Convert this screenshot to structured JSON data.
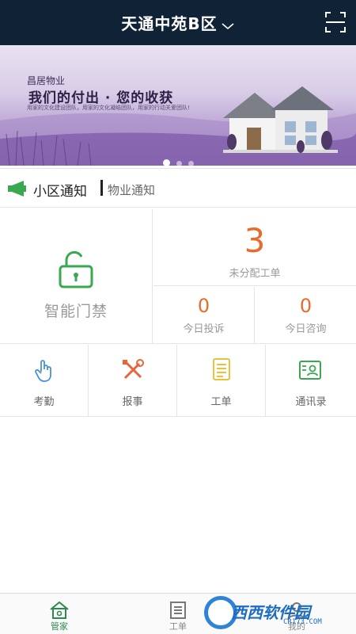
{
  "header": {
    "community_name": "天通中苑B区"
  },
  "banner": {
    "brand": "昌居物业",
    "slogan": "我们的付出 · 您的收获",
    "subtitle": "用家的文化建设团队，用家的文化凝结团队，用家的行动关爱团队!",
    "slide_count": 3,
    "active_slide": 1
  },
  "notice": {
    "primary_tab": "小区通知",
    "secondary_tab": "物业通知"
  },
  "gate": {
    "label": "智能门禁"
  },
  "stats": {
    "unassigned": {
      "value": "3",
      "label": "未分配工单"
    },
    "complaints": {
      "value": "0",
      "label": "今日投诉"
    },
    "inquiries": {
      "value": "0",
      "label": "今日咨询"
    }
  },
  "actions": [
    {
      "label": "考勤",
      "icon": "tap-hand-icon"
    },
    {
      "label": "报事",
      "icon": "tools-icon"
    },
    {
      "label": "工单",
      "icon": "document-icon"
    },
    {
      "label": "通讯录",
      "icon": "contact-card-icon"
    }
  ],
  "tabbar": [
    {
      "label": "管家",
      "icon": "home-icon",
      "active": true
    },
    {
      "label": "工单",
      "icon": "list-icon",
      "active": false
    },
    {
      "label": "我的",
      "icon": "user-icon",
      "active": false
    }
  ],
  "watermark": {
    "text": "西西软件园",
    "url": "CR173.COM"
  },
  "colors": {
    "header_bg": "#0f2236",
    "accent_orange": "#e86b2b",
    "accent_green": "#2c8a4e"
  }
}
